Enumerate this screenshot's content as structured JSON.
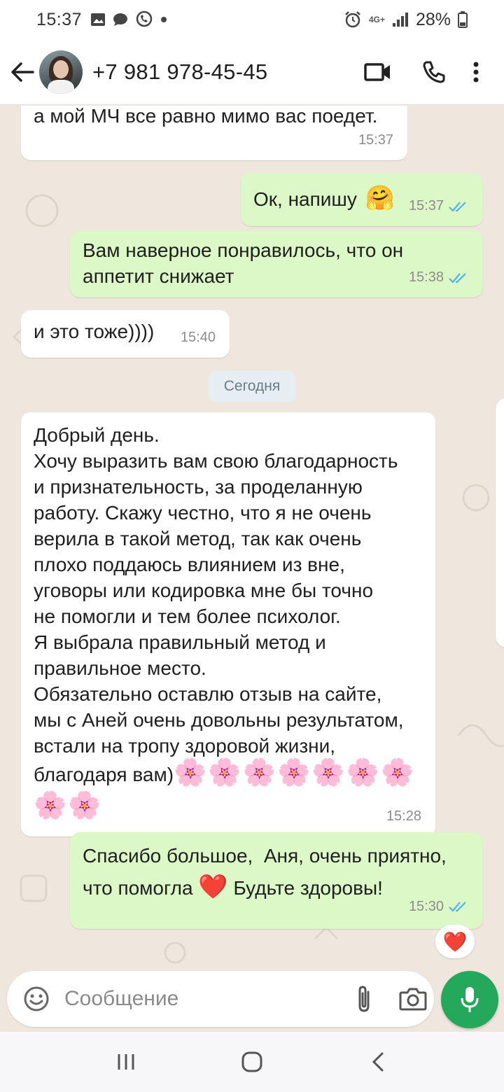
{
  "status_bar": {
    "time": "15:37",
    "network": "4G+",
    "battery": "28%"
  },
  "header": {
    "contact": "+7 981 978-45-45",
    "icons": [
      "back-arrow-icon",
      "video-call-icon",
      "phone-icon",
      "more-vert-icon"
    ]
  },
  "chat": {
    "date_divider": "Сегодня",
    "messages": [
      {
        "direction": "in",
        "text": "а мой МЧ все равно мимо вас поедет.",
        "time": "15:37"
      },
      {
        "direction": "out",
        "text": "Ок, напишу",
        "emoji": "🤗",
        "time": "15:37",
        "status": "read"
      },
      {
        "direction": "out",
        "text": "Вам наверное понравилось, что он\nаппетит снижает",
        "time": "15:38",
        "status": "read"
      },
      {
        "direction": "in",
        "text": "и это тоже))))",
        "time": "15:40"
      },
      {
        "direction": "in",
        "text": "Добрый день.\nХочу выразить вам свою благодарность\nи признательность, за проделанную\nработу. Скажу честно, что я не очень\nверила в такой метод, так как очень\nплохо поддаюсь влиянием из вне,\nуговоры или кодировка мне бы точно\nне помогли и тем более психолог.\nЯ выбрала правильный метод и\nправильное место.\nОбязательно оставлю отзыв на сайте,\nмы с Аней очень довольны результатом,\nвстали на тропу здоровой жизни,\nблагодаря вам)",
        "emoji": "🌸🌸🌸🌸🌸🌸🌸",
        "emoji_line2": "🌸🌸",
        "time": "15:28"
      },
      {
        "direction": "out",
        "text_part1": "Спасибо большое,  Аня, очень приятно,\nчто помогла",
        "emoji": "❤️",
        "text_part2": "Будьте здоровы!",
        "time": "15:30",
        "status": "read",
        "reaction": "❤️"
      }
    ]
  },
  "composer": {
    "placeholder": "Сообщение",
    "icons": [
      "emoji-icon",
      "attach-icon",
      "camera-icon",
      "mic-icon"
    ]
  },
  "navigation": {
    "icons": [
      "recent-apps-icon",
      "home-icon",
      "back-icon"
    ]
  },
  "colors": {
    "outgoing_bubble": "#dcf8c6",
    "incoming_bubble": "#ffffff",
    "chat_background": "#efe7dd",
    "accent": "#24a85c",
    "read_ticks": "#4fb3e8"
  }
}
